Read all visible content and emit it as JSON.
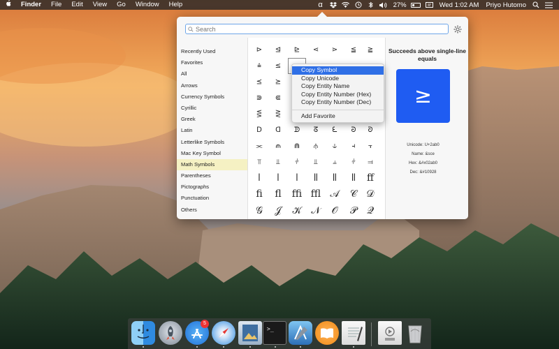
{
  "menubar": {
    "apple_icon": "apple-icon",
    "items": [
      "Finder",
      "File",
      "Edit",
      "View",
      "Go",
      "Window",
      "Help"
    ],
    "status": {
      "battery": "27%",
      "datetime": "Wed 1:02 AM",
      "user": "Priyo Hutomo"
    }
  },
  "panel": {
    "search_placeholder": "Search",
    "categories": [
      "Recently Used",
      "Favorites",
      "All",
      "Arrows",
      "Currency Symbols",
      "Cyrillic",
      "Greek",
      "Latin",
      "Letterlike Symbols",
      "Mac Key Symbol",
      "Math Symbols",
      "Parentheses",
      "Pictographs",
      "Punctuation",
      "Others"
    ],
    "selected_category": "Math Symbols",
    "grid_rows": [
      [
        "⊳",
        "⊴",
        "⊵",
        "⋖",
        "⋗",
        "≦",
        "≧"
      ],
      [
        "⩮",
        "≤",
        "≥",
        "",
        "",
        "",
        ""
      ],
      [
        "⪯",
        "⪰",
        "",
        "",
        "",
        "",
        ""
      ],
      [
        "⋑",
        "⋐",
        "",
        "",
        "",
        "",
        ""
      ],
      [
        "⋚",
        "⋛",
        "",
        "",
        "",
        "",
        ""
      ],
      [
        "ᗞ",
        "ᗡ",
        "ᗫ",
        "ᘔ",
        "ᘍ",
        "ᘒ",
        "ᘐ"
      ],
      [
        "⫘",
        "⫙",
        "⋒",
        "⫛",
        "⫝",
        "⫞",
        "⫟"
      ],
      [
        "⫪",
        "⫫",
        "⫩",
        "⫫",
        "⫨",
        "⫩",
        "⫤"
      ],
      [
        "ǀ",
        "ǀ",
        "ǀ",
        "ǁ",
        "ǁ",
        "ǁ",
        "ﬀ"
      ],
      [
        "ﬁ",
        "ﬂ",
        "ﬃ",
        "ﬄ",
        "𝒜",
        "𝒞",
        "𝒟"
      ],
      [
        "𝒢",
        "𝒥",
        "𝒦",
        "𝒩",
        "𝒪",
        "𝒫",
        "𝒬"
      ]
    ],
    "detail": {
      "title": "Succeeds above single-line equals",
      "glyph": "≥",
      "unicode": "Unicode: U+2ab0",
      "name": "Name: &sce",
      "hex": "Hex: &#x02ab0",
      "dec": "Dec: &#10928"
    },
    "context_menu": {
      "items": [
        "Copy Symbol",
        "Copy Unicode",
        "Copy Entity Name",
        "Copy Entity Number (Hex)",
        "Copy Entity Number (Dec)"
      ],
      "highlighted": "Copy Symbol",
      "extra": "Add Favorite"
    }
  },
  "dock": {
    "app_store_badge": "5",
    "items": [
      "finder-icon",
      "launchpad-icon",
      "app-store-icon",
      "safari-icon",
      "preview-icon",
      "terminal-icon",
      "xcode-icon",
      "ibooks-icon",
      "textedit-icon",
      "document-icon",
      "trash-icon"
    ]
  }
}
